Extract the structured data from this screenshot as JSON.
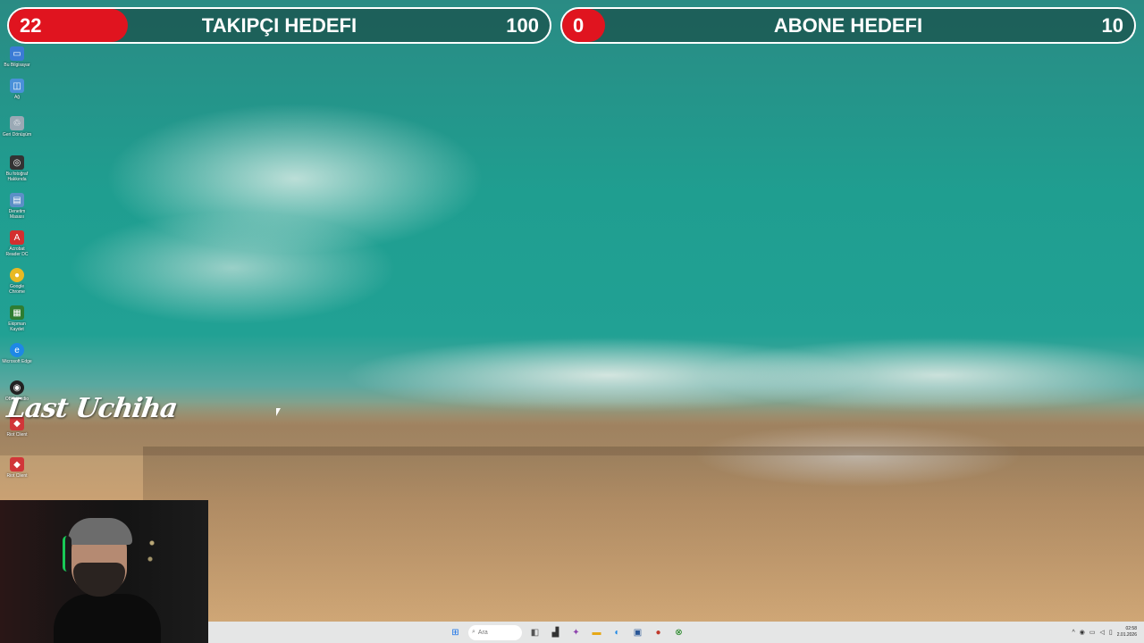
{
  "goals": {
    "followers": {
      "current": "22",
      "title": "TAKIPÇI HEDEFI",
      "target": "100",
      "progress": 0.22
    },
    "subscribers": {
      "current": "0",
      "title": "ABONE HEDEFI",
      "target": "10",
      "progress": 0.0
    }
  },
  "colors": {
    "goal_fill": "#e0141f",
    "goal_border": "#ffffff"
  },
  "desktop_icons": [
    {
      "label": "Bu Bilgisayar",
      "icon": "computer-icon"
    },
    {
      "label": "Ağ",
      "icon": "network-icon"
    },
    {
      "label": "Geri Dönüşüm",
      "icon": "recycle-bin-icon"
    },
    {
      "label": "Bu fotoğraf Hakkında",
      "icon": "camera-icon"
    },
    {
      "label": "Denetim Masası",
      "icon": "control-panel-icon"
    },
    {
      "label": "Acrobat Reader DC",
      "icon": "acrobat-icon"
    },
    {
      "label": "Google Chrome",
      "icon": "chrome-icon"
    },
    {
      "label": "Ekipman Kaydet",
      "icon": "app-icon"
    },
    {
      "label": "Microsoft Edge",
      "icon": "edge-icon"
    },
    {
      "label": "OBS Studio",
      "icon": "obs-icon"
    },
    {
      "label": "Riot Client",
      "icon": "riot-icon"
    },
    {
      "label": "Riot Client",
      "icon": "riot-icon"
    }
  ],
  "watermark": "Last Uchiha",
  "taskbar": {
    "search_placeholder": "Ara",
    "apps": [
      "start-icon",
      "search-icon",
      "task-view-icon",
      "files-icon",
      "copilot-icon",
      "explorer-icon",
      "edge-icon",
      "store-icon",
      "game-icon",
      "xbox-icon"
    ],
    "time": "02:58",
    "date": "2.01.2026"
  }
}
